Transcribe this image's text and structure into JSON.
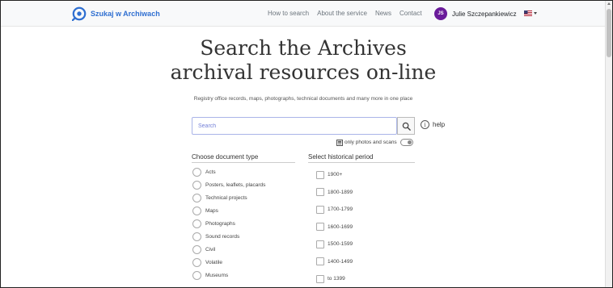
{
  "nav": {
    "brand": "Szukaj w Archiwach",
    "links": [
      "How to search",
      "About the service",
      "News",
      "Contact"
    ],
    "user_initials": "JS",
    "user_name": "Julie Szczepankiewicz",
    "accent_color": "#2f6fd1",
    "avatar_color": "#6a1b9a",
    "language_flag": "us-flag-icon"
  },
  "hero": {
    "title_line1": "Search the Archives",
    "title_line2": "archival resources on-line",
    "subtitle": "Registry office records, maps, photographs, technical documents and many more in one place"
  },
  "search": {
    "placeholder": "Search",
    "help_label": "help",
    "only_photos_label": "only photos and scans"
  },
  "document_types": {
    "header": "Choose document type",
    "items": [
      "Acts",
      "Posters, leaflets, placards",
      "Technical projects",
      "Maps",
      "Photographs",
      "Sound records",
      "Civil",
      "Volatile",
      "Museums"
    ]
  },
  "periods": {
    "header": "Select historical period",
    "items": [
      "1900+",
      "1800-1899",
      "1700-1799",
      "1600-1699",
      "1500-1599",
      "1400-1499",
      "to 1399"
    ]
  }
}
